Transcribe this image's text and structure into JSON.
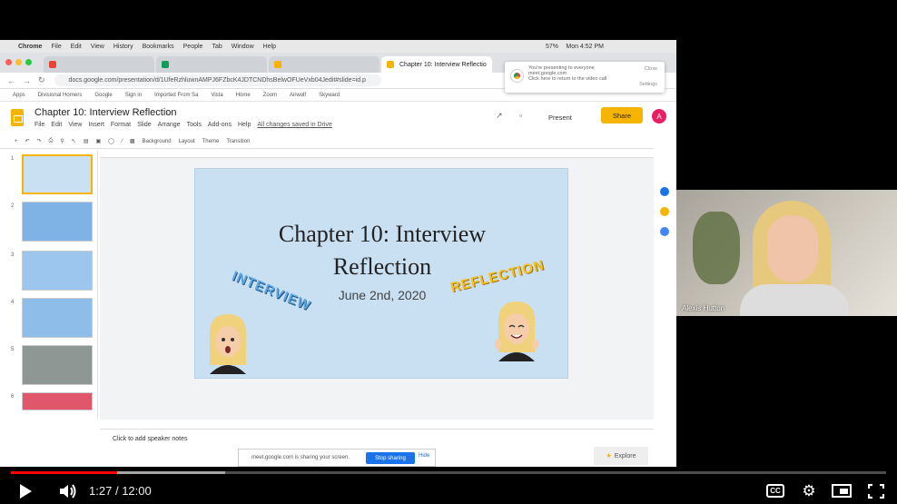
{
  "mac_menubar": {
    "items": [
      "Chrome",
      "File",
      "Edit",
      "View",
      "History",
      "Bookmarks",
      "People",
      "Tab",
      "Window",
      "Help"
    ],
    "battery": "57%",
    "clock": "Mon 4:52 PM"
  },
  "browser": {
    "tabs": [
      {
        "label": "",
        "active": false,
        "color": "#ea4335"
      },
      {
        "label": "",
        "active": false,
        "color": "#0f9d58"
      },
      {
        "label": "",
        "active": false,
        "color": "#f4b400"
      },
      {
        "label": "Chapter 10: Interview Reflectio",
        "active": true,
        "color": "#f4b400"
      }
    ],
    "url": "docs.google.com/presentation/d/1UfeRzhluwnAMPJ6FZbcK4JDTCNDhsBelwOFUeVxb04Jedit#slide=id.p",
    "bookmarks": [
      "Apps",
      "Divisional Horners",
      "Google",
      "Sign in",
      "Imported From Sa",
      "Vista",
      "Home",
      "Zoom",
      "Airwolf",
      "Skyward"
    ],
    "notification": {
      "line1": "You're presenting to everyone",
      "line2": "meet.google.com",
      "line3": "Click here to return to the video call",
      "close": "Close",
      "settings": "Settings"
    }
  },
  "docs": {
    "title": "Chapter 10: Interview Reflection",
    "menus": [
      "File",
      "Edit",
      "View",
      "Insert",
      "Format",
      "Slide",
      "Arrange",
      "Tools",
      "Add-ons",
      "Help"
    ],
    "saved_status": "All changes saved in Drive",
    "present_label": "Present",
    "share_label": "Share",
    "avatar_initial": "A",
    "toolbar": [
      "Background",
      "Layout",
      "Theme",
      "Transition"
    ],
    "slide_numbers": [
      "1",
      "2",
      "3",
      "4",
      "5",
      "6"
    ],
    "notes_placeholder": "Click to add speaker notes",
    "explore_label": "Explore"
  },
  "slide": {
    "title_line1": "Chapter 10: Interview",
    "title_line2": "Reflection",
    "date": "June 2nd, 2020",
    "sticker_left": "INTERVIEW",
    "sticker_right": "REFLECTION"
  },
  "sharing_bar": {
    "text": "meet.google.com is sharing your screen.",
    "stop": "Stop sharing",
    "hide": "Hide"
  },
  "webcam": {
    "name": "Alexis Hutton"
  },
  "player": {
    "time_current": "1:27",
    "time_separator": "/",
    "time_total": "12:00",
    "played_fraction": 0.121,
    "buffered_fraction": 0.245,
    "progress_color": "#ff0000"
  }
}
